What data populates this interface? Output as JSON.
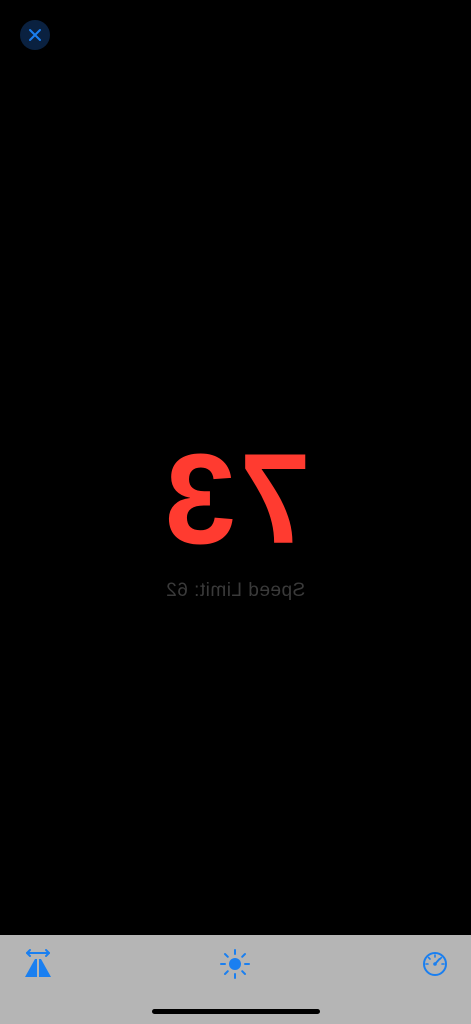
{
  "hud": {
    "speed": "73",
    "speed_limit_label": "Speed Limit: 62"
  },
  "icons": {
    "close": "close-icon",
    "mirror": "road-mirror-icon",
    "brightness": "sun-icon",
    "speedometer": "speedometer-icon"
  },
  "colors": {
    "speed": "#ff3b30",
    "accent": "#1a7ff0",
    "toolbar_background": "#b5b5b5",
    "background": "#000000"
  }
}
